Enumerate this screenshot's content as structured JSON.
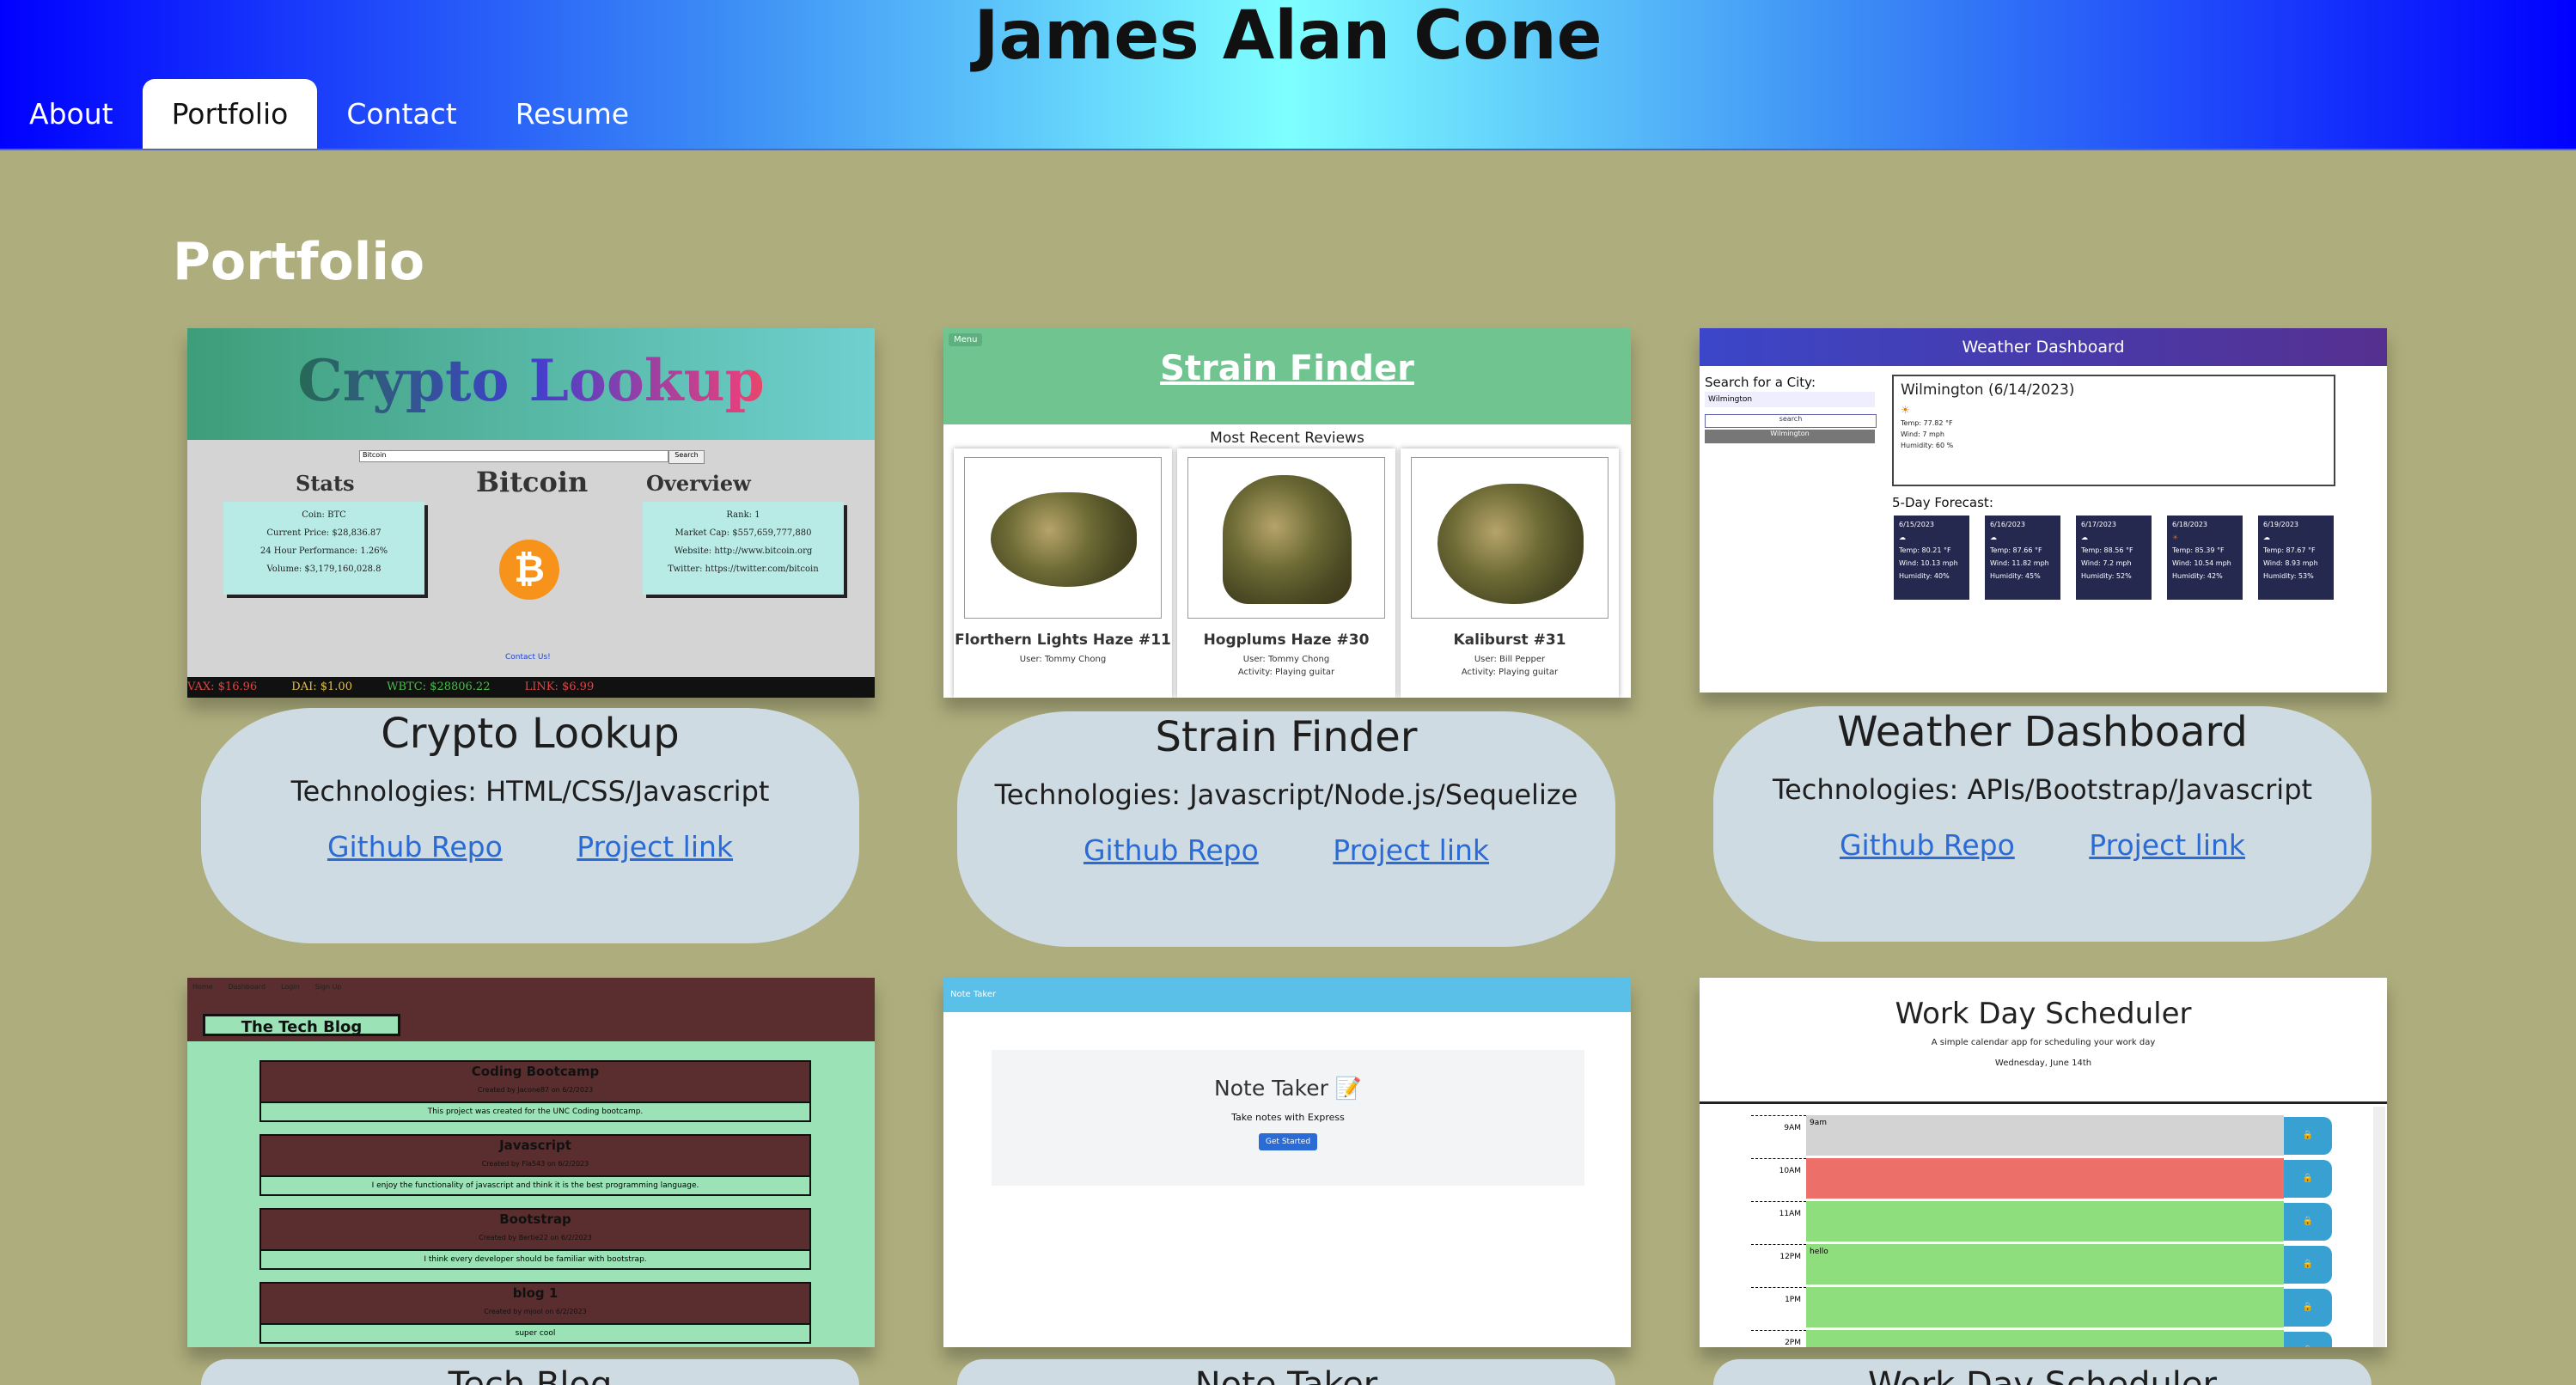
{
  "header": {
    "title": "James Alan Cone",
    "nav": [
      "About",
      "Portfolio",
      "Contact",
      "Resume"
    ],
    "active_tab": "Portfolio"
  },
  "section": {
    "title": "Portfolio"
  },
  "projects": [
    {
      "name": "Crypto Lookup",
      "tech": "Technologies: HTML/CSS/Javascript",
      "repo": "Github Repo",
      "link": "Project link"
    },
    {
      "name": "Strain Finder",
      "tech": "Technologies: Javascript/Node.js/Sequelize",
      "repo": "Github Repo",
      "link": "Project link"
    },
    {
      "name": "Weather Dashboard",
      "tech": "Technologies: APIs/Bootstrap/Javascript",
      "repo": "Github Repo",
      "link": "Project link"
    },
    {
      "name": "Tech Blog"
    },
    {
      "name": "Note Taker"
    },
    {
      "name": "Work Day Scheduler"
    }
  ],
  "crypto_shot": {
    "title": "Crypto Lookup",
    "search_placeholder": "Bitcoin",
    "search_btn": "Search",
    "stats_title": "Stats",
    "coin_title": "Bitcoin",
    "overview_title": "Overview",
    "stats": [
      "Coin: BTC",
      "Current Price: $28,836.87",
      "24 Hour Performance: 1.26%",
      "Volume: $3,179,160,028.8"
    ],
    "overview": [
      "Rank: 1",
      "Market Cap: $557,659,777,880",
      "Website: http://www.bitcoin.org",
      "Twitter: https://twitter.com/bitcoin"
    ],
    "contact": "Contact Us!",
    "ticker": [
      "VAX: $16.96",
      "DAI: $1.00",
      "WBTC: $28806.22",
      "LINK: $6.99"
    ]
  },
  "strain_shot": {
    "menu": "Menu",
    "title": "Strain Finder",
    "subtitle": "Most Recent Reviews",
    "cards": [
      {
        "name": "Florthern Lights Haze #11",
        "user": "User: Tommy Chong",
        "activity": ""
      },
      {
        "name": "Hogplums Haze #30",
        "user": "User: Tommy Chong",
        "activity": "Activity: Playing guitar"
      },
      {
        "name": "Kaliburst #31",
        "user": "User: Bill Pepper",
        "activity": "Activity: Playing guitar"
      }
    ]
  },
  "weather_shot": {
    "title": "Weather Dashboard",
    "search_label": "Search for a City:",
    "input_value": "Wilmington",
    "search_btn": "search",
    "history": "Wilmington",
    "current_city": "Wilmington (6/14/2023)",
    "current": [
      "Temp: 77.82 °F",
      "Wind: 7 mph",
      "Humidity: 60 %"
    ],
    "forecast_label": "5-Day Forecast:",
    "days": [
      {
        "date": "6/15/2023",
        "temp": "Temp: 80.21 °F",
        "wind": "Wind: 10.13 mph",
        "hum": "Humidity: 40%"
      },
      {
        "date": "6/16/2023",
        "temp": "Temp: 87.66 °F",
        "wind": "Wind: 11.82 mph",
        "hum": "Humidity: 45%"
      },
      {
        "date": "6/17/2023",
        "temp": "Temp: 88.56 °F",
        "wind": "Wind: 7.2 mph",
        "hum": "Humidity: 52%"
      },
      {
        "date": "6/18/2023",
        "temp": "Temp: 85.39 °F",
        "wind": "Wind: 10.54 mph",
        "hum": "Humidity: 42%"
      },
      {
        "date": "6/19/2023",
        "temp": "Temp: 87.67 °F",
        "wind": "Wind: 8.93 mph",
        "hum": "Humidity: 53%"
      }
    ]
  },
  "blog_shot": {
    "nav": [
      "Home",
      "Dashboard",
      "Login",
      "Sign Up"
    ],
    "title": "The Tech Blog",
    "posts": [
      {
        "title": "Coding Bootcamp",
        "by": "Created by Jacone87 on 6/2/2023",
        "body": "This project was created for the UNC Coding bootcamp."
      },
      {
        "title": "Javascript",
        "by": "Created by Fla543 on 6/2/2023",
        "body": "I enjoy the functionality of javascript and think it is the best programming language."
      },
      {
        "title": "Bootstrap",
        "by": "Created by Bertie22 on 6/2/2023",
        "body": "I think every developer should be familiar with bootstrap."
      },
      {
        "title": "blog 1",
        "by": "Created by mjool on 6/2/2023",
        "body": "super cool"
      }
    ]
  },
  "note_shot": {
    "bar": "Note Taker",
    "title": "Note Taker 📝",
    "sub": "Take notes with Express",
    "btn": "Get Started"
  },
  "sched_shot": {
    "title": "Work Day Scheduler",
    "sub": "A simple calendar app for scheduling your work day",
    "date": "Wednesday, June 14th",
    "rows": [
      {
        "hour": "9AM",
        "text": "9am",
        "color": "#d3d3d3"
      },
      {
        "hour": "10AM",
        "text": "",
        "color": "#ec6f6a"
      },
      {
        "hour": "11AM",
        "text": "",
        "color": "#8fde7d"
      },
      {
        "hour": "12PM",
        "text": "hello",
        "color": "#8fde7d"
      },
      {
        "hour": "1PM",
        "text": "",
        "color": "#8fde7d"
      },
      {
        "hour": "2PM",
        "text": "",
        "color": "#8fde7d"
      }
    ]
  }
}
